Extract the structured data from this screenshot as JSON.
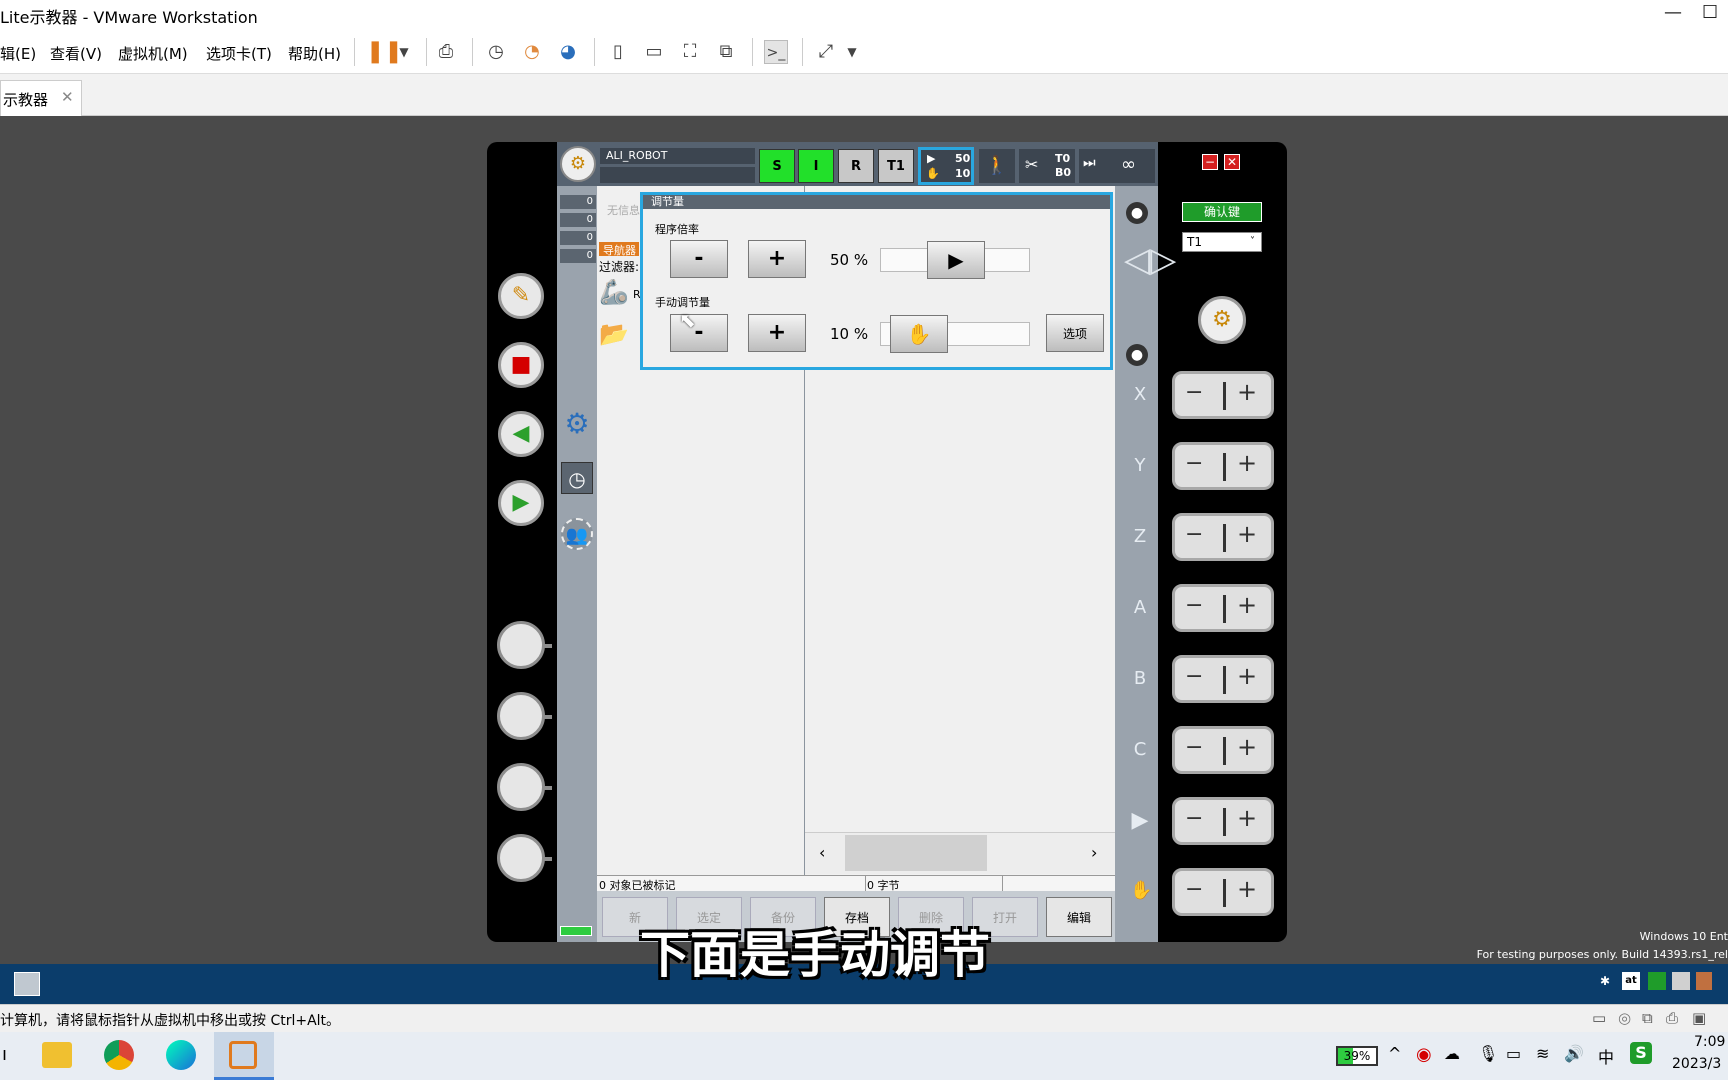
{
  "window": {
    "title": "Lite示教器 - VMware Workstation",
    "min_icon": "minimize-icon",
    "max_icon": "maximize-icon"
  },
  "menu": {
    "items": [
      "辑(E)",
      "查看(V)",
      "虚拟机(M)",
      "选项卡(T)",
      "帮助(H)"
    ]
  },
  "tab": {
    "label": "示教器",
    "close": "✕"
  },
  "pendant": {
    "robot_name": "ALI_ROBOT",
    "status_buttons": [
      "S",
      "I",
      "R",
      "T1"
    ],
    "override_prog": "50",
    "override_jog": "10",
    "tool_base": [
      "T0",
      "B0"
    ],
    "infinity": "∞",
    "confirm_label": "确认键",
    "mode_select": "T1",
    "counts": [
      "0",
      "0",
      "0",
      "0"
    ],
    "nav_title": "导航器",
    "filter_label": "过滤器:",
    "nav_hint": "无信息",
    "nav_row1": "R",
    "status_left": "0 对象已被标记",
    "status_right": "0 字节",
    "bottom_buttons": [
      {
        "label": "新",
        "on": false
      },
      {
        "label": "选定",
        "on": false
      },
      {
        "label": "备份",
        "on": false
      },
      {
        "label": "存档",
        "on": true
      },
      {
        "label": "删除",
        "on": false
      },
      {
        "label": "打开",
        "on": false
      },
      {
        "label": "编辑",
        "on": true
      }
    ],
    "axes": [
      "X",
      "Y",
      "Z",
      "A",
      "B",
      "C"
    ]
  },
  "dialog": {
    "title": "调节量",
    "prog_label": "程序倍率",
    "prog_value": "50 %",
    "prog_override": 50,
    "manual_label": "手动调节量",
    "manual_value": "10 %",
    "manual_override": 10,
    "minus": "-",
    "plus": "+",
    "options_label": "选项"
  },
  "guest": {
    "watermark1": "Windows 10 Ent",
    "watermark2": "For testing purposes only. Build 14393.rs1_rel"
  },
  "statusbar": {
    "message": "计算机，请将鼠标指针从虚拟机中移出或按 Ctrl+Alt。"
  },
  "host_taskbar": {
    "battery": "39%",
    "ime": "中",
    "time": "7:09",
    "date": "2023/3"
  },
  "caption": "下面是手动调节",
  "colors": {
    "dialog_border": "#29a7e0",
    "active_green": "#22e02a",
    "confirm_green": "#1f9c2a"
  }
}
